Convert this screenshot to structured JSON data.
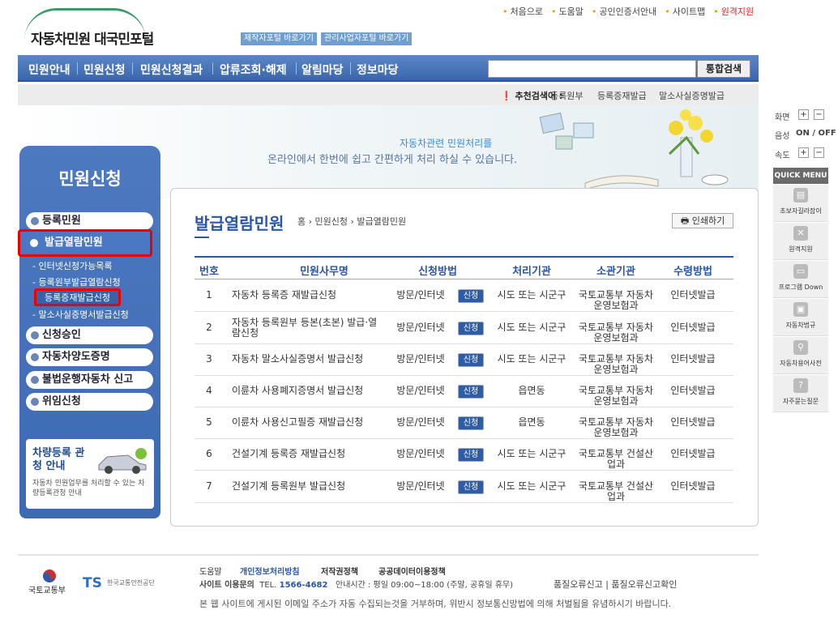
{
  "top_links": [
    "처음으로",
    "도움말",
    "공인인증서안내",
    "사이트맵",
    "원격지원"
  ],
  "logo": {
    "text": "자동차민원 대국민포털"
  },
  "shortcuts": [
    "제작자포털 바로가기",
    "관리사업자포털 바로가기"
  ],
  "nav": [
    "민원안내",
    "민원신청",
    "민원신청결과",
    "압류조회·해제",
    "알림마당",
    "정보마당"
  ],
  "search": {
    "button": "통합검색",
    "value": ""
  },
  "recommend": {
    "label": "추천검색어 :",
    "keywords": [
      "등록원부",
      "등록증재발급",
      "말소사실증명발급"
    ]
  },
  "banner": {
    "line1": "자동차관련 민원처리를",
    "line2": "온라인에서 한번에 쉽고 간편하게 처리 하실 수 있습니다."
  },
  "sidebar": {
    "title": "민원신청",
    "items": [
      "등록민원",
      "발급열람민원",
      "신청승인",
      "자동차양도증명",
      "불법운행자동차 신고",
      "위임신청"
    ],
    "subitems": [
      "인터넷신청가능목록",
      "등록원부발급열람신청",
      "등록증재발급신청",
      "말소사실증명서발급신청"
    ],
    "car_box": {
      "title": "차량등록 관청 안내",
      "desc": "자동차 민원업무를 처리할 수 있는 차량등록관청 안내"
    }
  },
  "page": {
    "title": "발급열람민원",
    "breadcrumb": [
      "홈",
      "민원신청",
      "발급열람민원"
    ],
    "print": "인쇄하기"
  },
  "table": {
    "headers": [
      "번호",
      "민원사무명",
      "신청방법",
      "처리기관",
      "소관기관",
      "수령방법"
    ],
    "apply_label": "신청",
    "rows": [
      {
        "no": "1",
        "name": "자동차 등록증 재발급신청",
        "method": "방문/인터넷",
        "proc": "시도 또는 시군구",
        "org": "국토교통부 자동차운영보험과",
        "recv": "인터넷발급"
      },
      {
        "no": "2",
        "name": "자동차 등록원부 등본(초본) 발급·열람신청",
        "method": "방문/인터넷",
        "proc": "시도 또는 시군구",
        "org": "국토교통부 자동차운영보험과",
        "recv": "인터넷발급"
      },
      {
        "no": "3",
        "name": "자동차 말소사실증명서 발급신청",
        "method": "방문/인터넷",
        "proc": "시도 또는 시군구",
        "org": "국토교통부 자동차운영보험과",
        "recv": "인터넷발급"
      },
      {
        "no": "4",
        "name": "이륜차 사용폐지증명서 발급신청",
        "method": "방문/인터넷",
        "proc": "읍면동",
        "org": "국토교통부 자동차운영보험과",
        "recv": "인터넷발급"
      },
      {
        "no": "5",
        "name": "이륜차 사용신고필증 재발급신청",
        "method": "방문/인터넷",
        "proc": "읍면동",
        "org": "국토교통부 자동차운영보험과",
        "recv": "인터넷발급"
      },
      {
        "no": "6",
        "name": "건설기계 등록증 재발급신청",
        "method": "방문/인터넷",
        "proc": "시도 또는 시군구",
        "org": "국토교통부 건설산업과",
        "recv": "인터넷발급"
      },
      {
        "no": "7",
        "name": "건설기계 등록원부 발급신청",
        "method": "방문/인터넷",
        "proc": "시도 또는 시군구",
        "org": "국토교통부 건설산업과",
        "recv": "인터넷발급"
      }
    ]
  },
  "quick": {
    "screen": "화면",
    "sound": "음성",
    "sound_state": "ON / OFF",
    "speed": "속도",
    "title": "QUICK MENU",
    "items": [
      "초보자길라잡이",
      "원격지원",
      "프로그램 Down",
      "자동차법규",
      "자동차용어사전",
      "자주묻는질문"
    ]
  },
  "footer": {
    "org1": "국토교통부",
    "org2": "TS",
    "org2_sub": "한국교통안전공단",
    "links": [
      "도움말",
      "개인정보처리방침",
      "저작권정책",
      "공공데이터이용정책"
    ],
    "info_label": "사이트 이용문의",
    "tel_label": "TEL.",
    "tel": "1566-4682",
    "hours": "안내시간 : 평일 09:00~18:00 (주말, 공휴일 휴무)",
    "err": "품질오류신고 | 품질오류신고확인",
    "notice": "본 웹 사이트에 게시된 이메일 주소가 자동 수집되는것을 거부하며, 위반시 정보통신망법에 의해 처벌됨을 유념하시기 바랍니다."
  }
}
